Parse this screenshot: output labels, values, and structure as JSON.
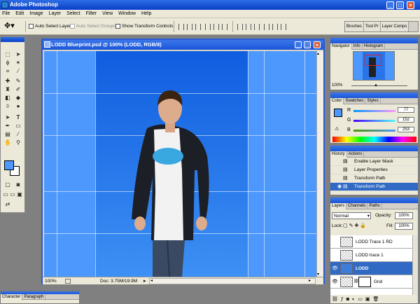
{
  "app": {
    "title": "Adobe Photoshop"
  },
  "menu": [
    "File",
    "Edit",
    "Image",
    "Layer",
    "Select",
    "Filter",
    "View",
    "Window",
    "Help"
  ],
  "options": {
    "auto_select_layer": "Auto Select Layer",
    "auto_select_groups": "Auto Select Groups",
    "show_transform_controls": "Show Transform Controls"
  },
  "palette_well": [
    "Brushes",
    "Tool Pr",
    "Layer Comps"
  ],
  "document": {
    "title": "LODD Blueprint.psd @ 100% (LODD, RGB/8)",
    "zoom": "100%",
    "doc_info": "Doc: 3.75M/19.9M"
  },
  "navigator": {
    "tabs": [
      "Navigator",
      "Info",
      "Histogram"
    ],
    "zoom": "100%"
  },
  "color": {
    "tabs": [
      "Color",
      "Swatches",
      "Styles"
    ],
    "r_label": "R",
    "g_label": "G",
    "b_label": "B",
    "r": "77",
    "g": "152",
    "b": "253",
    "foreground": "#4d98fd"
  },
  "history": {
    "tabs": [
      "History",
      "Actions"
    ],
    "items": [
      "Enable Layer Mask",
      "Layer Properties",
      "Transform Path",
      "Transform Path"
    ]
  },
  "layers": {
    "tabs": [
      "Layers",
      "Channels",
      "Paths"
    ],
    "blend_mode": "Normal",
    "opacity_label": "Opacity:",
    "opacity": "100%",
    "lock_label": "Lock:",
    "fill_label": "Fill:",
    "fill": "100%",
    "items": [
      "LODD Trace 1 RD",
      "LODD trace 1",
      "LODD",
      "Grid"
    ]
  },
  "character": {
    "tabs": [
      "Character",
      "Paragraph"
    ]
  }
}
